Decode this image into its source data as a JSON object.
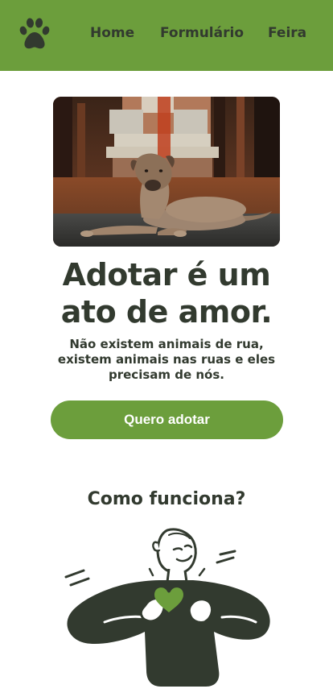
{
  "header": {
    "logo_icon": "paw-icon",
    "nav": [
      {
        "label": "Home"
      },
      {
        "label": "Formulário"
      },
      {
        "label": "Feira"
      }
    ]
  },
  "hero": {
    "title": "Adotar é um ato de amor.",
    "subtitle": "Não existem animais de rua, existem animais nas ruas e eles precisam de nós.",
    "cta_label": "Quero adotar"
  },
  "how_it_works": {
    "title": "Como funciona?",
    "illustration_icon": "person-heart-icon"
  },
  "colors": {
    "brand_green": "#6c9e3c",
    "text_dark": "#323a2f",
    "background": "#ffffff"
  }
}
